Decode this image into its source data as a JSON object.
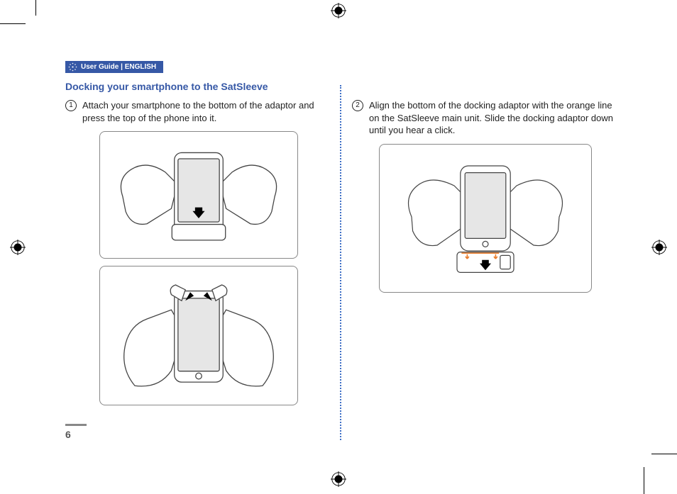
{
  "header": {
    "label": "User Guide  |  ENGLISH"
  },
  "section_title": "Docking your smartphone to the SatSleeve",
  "steps": {
    "1": {
      "num": "1",
      "text": "Attach your smartphone to the bottom of the adaptor and press the top of the phone into it."
    },
    "2": {
      "num": "2",
      "text": "Align the bottom of the docking adaptor with the orange line on the SatSleeve main unit. Slide the docking adaptor down until you hear a click."
    }
  },
  "page_number": "6",
  "colors": {
    "accent": "#3658a6",
    "orange": "#e87b2a"
  }
}
